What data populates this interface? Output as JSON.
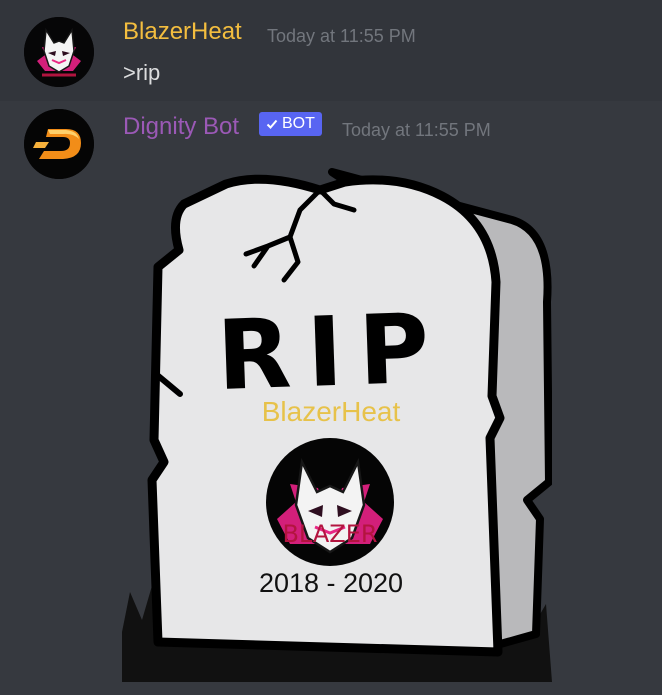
{
  "messages": [
    {
      "author": "BlazerHeat",
      "author_color": "#f4be3f",
      "timestamp": "Today at 11:55 PM",
      "text": ">rip",
      "avatar_icon": "fox-mask-avatar-icon"
    },
    {
      "author": "Dignity Bot",
      "author_color": "#9b59b6",
      "timestamp": "Today at 11:55 PM",
      "bot_tag": "BOT",
      "bot_tag_icon": "checkmark-icon",
      "avatar_icon": "d-logo-avatar-icon",
      "embed": {
        "title": "RIP",
        "name": "BlazerHeat",
        "avatar_text": "BLAZER",
        "years": "2018 - 2020"
      }
    }
  ],
  "colors": {
    "background": "#36393f",
    "hover_band": "#32353b",
    "bot_tag": "#5865f2",
    "grave_name": "#e7c24a"
  }
}
